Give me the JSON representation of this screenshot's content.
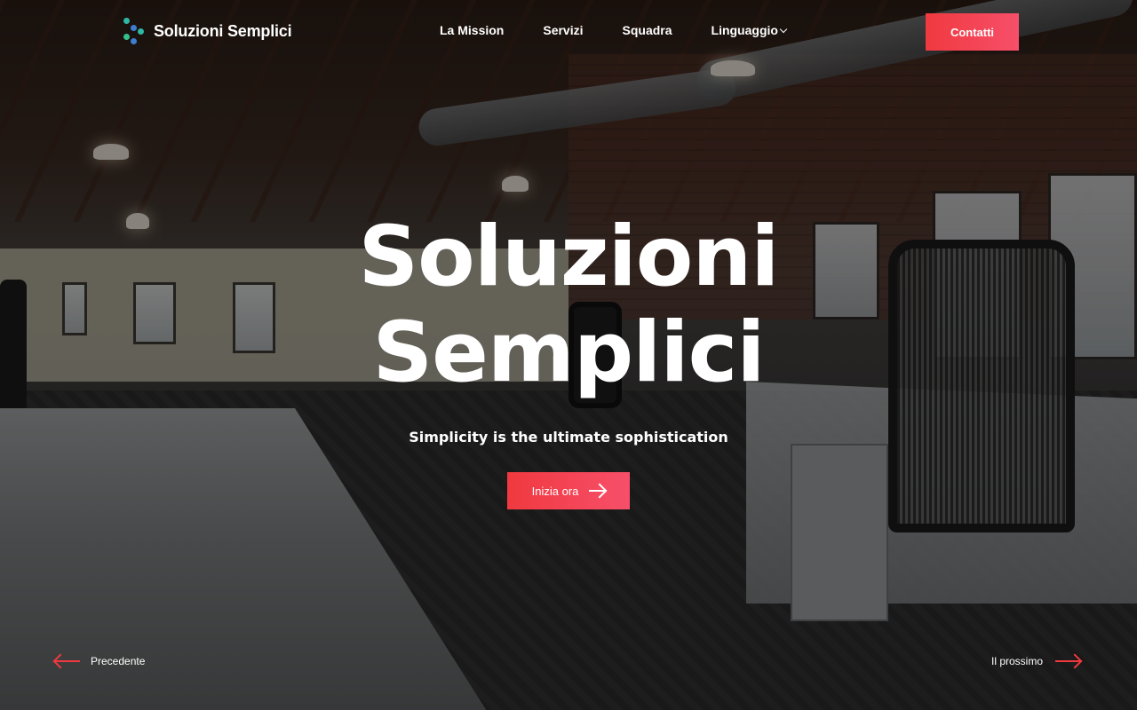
{
  "brand": {
    "name": "Soluzioni Semplici",
    "logo_icon": "molecule-icon",
    "logo_colors": [
      "#2fb8a6",
      "#3b7fd1",
      "#35c08c"
    ]
  },
  "nav": {
    "items": [
      {
        "label": "La Mission"
      },
      {
        "label": "Servizi"
      },
      {
        "label": "Squadra"
      },
      {
        "label": "Linguaggio",
        "dropdown": true
      }
    ],
    "contact_label": "Contatti"
  },
  "hero": {
    "title_line1": "Soluzioni",
    "title_line2": "Semplici",
    "subtitle": "Simplicity is the ultimate sophistication",
    "cta_label": "Inizia ora"
  },
  "slider": {
    "prev_label": "Precedente",
    "next_label": "Il prossimo"
  },
  "colors": {
    "accent_start": "#f0393f",
    "accent_end": "#f74f6a"
  }
}
